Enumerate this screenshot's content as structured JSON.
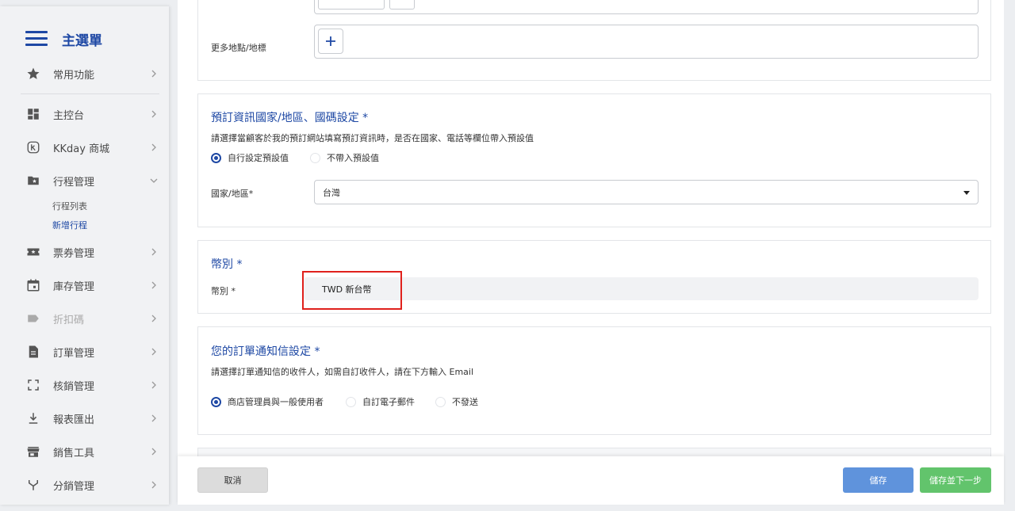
{
  "sidebar": {
    "title": "主選單",
    "items": [
      {
        "label": "常用功能",
        "icon": "star-icon"
      },
      {
        "label": "主控台",
        "icon": "dashboard-icon"
      },
      {
        "label": "KKday 商城",
        "icon": "kkday-icon"
      },
      {
        "label": "行程管理",
        "icon": "folder-star-icon"
      },
      {
        "label": "票券管理",
        "icon": "ticket-icon"
      },
      {
        "label": "庫存管理",
        "icon": "calendar-icon"
      },
      {
        "label": "折扣碼",
        "icon": "tag-icon"
      },
      {
        "label": "訂單管理",
        "icon": "document-icon"
      },
      {
        "label": "核銷管理",
        "icon": "scan-icon"
      },
      {
        "label": "報表匯出",
        "icon": "download-icon"
      },
      {
        "label": "銷售工具",
        "icon": "store-icon"
      },
      {
        "label": "分銷管理",
        "icon": "fork-icon"
      }
    ],
    "sub_items": [
      "行程列表",
      "新增行程"
    ]
  },
  "location": {
    "more_label": "更多地點/地標",
    "add_icon": "plus-icon"
  },
  "booking_region": {
    "title": "預訂資訊國家/地區、國碼設定 *",
    "description": "請選擇當顧客於我的預訂網站填寫預訂資訊時，是否在國家、電話等欄位帶入預設值",
    "option_custom": "自行設定預設值",
    "option_none": "不帶入預設值",
    "country_label": "國家/地區*",
    "country_value": "台灣"
  },
  "currency": {
    "title": "幣別 *",
    "label": "幣別 *",
    "value": "TWD 新台幣"
  },
  "notification": {
    "title": "您的訂單通知信設定 *",
    "description": "請選擇訂單通知信的收件人，如需自訂收件人，請在下方輸入 Email",
    "option_admin": "商店管理員與一般使用者",
    "option_custom": "自訂電子郵件",
    "option_none": "不發送"
  },
  "footer": {
    "cancel": "取消",
    "save": "儲存",
    "save_next": "儲存並下一步"
  },
  "colors": {
    "brand": "#1e48a4",
    "save": "#5f93dc",
    "save_next": "#62c46c",
    "highlight": "#e0211c"
  }
}
